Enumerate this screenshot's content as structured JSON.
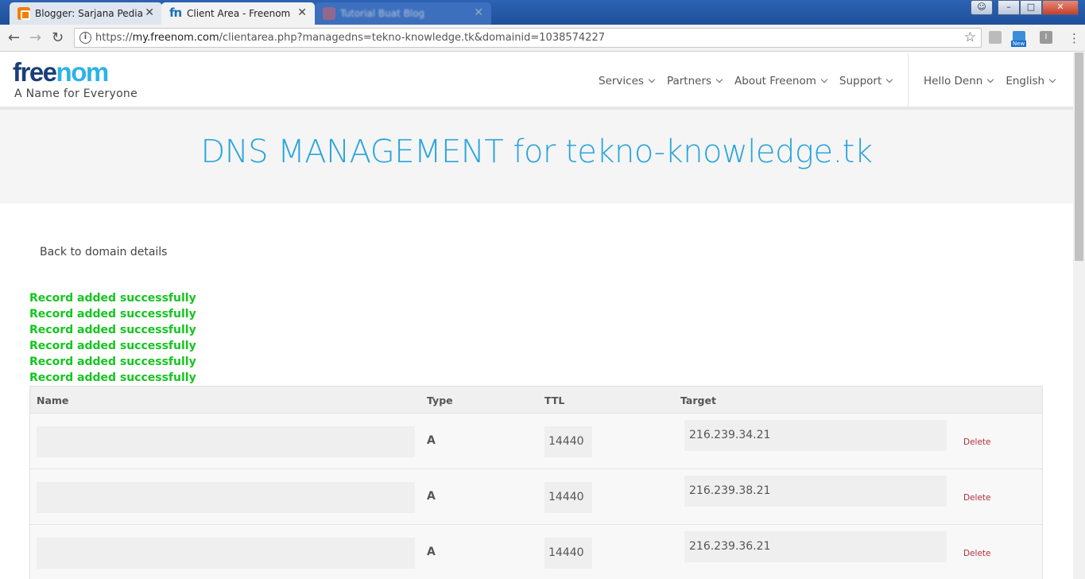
{
  "browser": {
    "tabs": [
      {
        "title": "Blogger: Sarjana Pedia - …",
        "close": "✕"
      },
      {
        "title": "Client Area - Freenom",
        "close": "✕"
      },
      {
        "title": "Tutorial Buat Blog",
        "close": "✕"
      }
    ],
    "url_prefix": "https://",
    "url_host": "my.freenom.com",
    "url_path": "/clientarea.php?managedns=tekno-knowledge.tk&domainid=1038574227",
    "ext_new_label": "New",
    "ext_i_label": "I",
    "window_buttons": {
      "minimize": "–",
      "maximize": "□",
      "close": "✕"
    }
  },
  "site": {
    "logo_free": "free",
    "logo_nom": "nom",
    "tagline": "A Name for Everyone",
    "nav": [
      {
        "label": "Services"
      },
      {
        "label": "Partners"
      },
      {
        "label": "About Freenom"
      },
      {
        "label": "Support"
      }
    ],
    "user_nav": [
      {
        "label": "Hello Denn"
      },
      {
        "label": "English"
      }
    ]
  },
  "page": {
    "title": "DNS MANAGEMENT for tekno-knowledge.tk",
    "back_link": "Back to domain details",
    "messages": [
      "Record added successfully",
      "Record added successfully",
      "Record added successfully",
      "Record added successfully",
      "Record added successfully",
      "Record added successfully"
    ],
    "table": {
      "columns": {
        "name": "Name",
        "type": "Type",
        "ttl": "TTL",
        "target": "Target"
      },
      "rows": [
        {
          "name": "",
          "type": "A",
          "ttl": "14440",
          "target": "216.239.34.21",
          "action": "Delete"
        },
        {
          "name": "",
          "type": "A",
          "ttl": "14440",
          "target": "216.239.38.21",
          "action": "Delete"
        },
        {
          "name": "",
          "type": "A",
          "ttl": "14440",
          "target": "216.239.36.21",
          "action": "Delete"
        }
      ]
    }
  },
  "colors": {
    "accent": "#2aa5db",
    "logo_dark": "#1a3e78",
    "success": "#15c520",
    "delete": "#b0303a"
  }
}
